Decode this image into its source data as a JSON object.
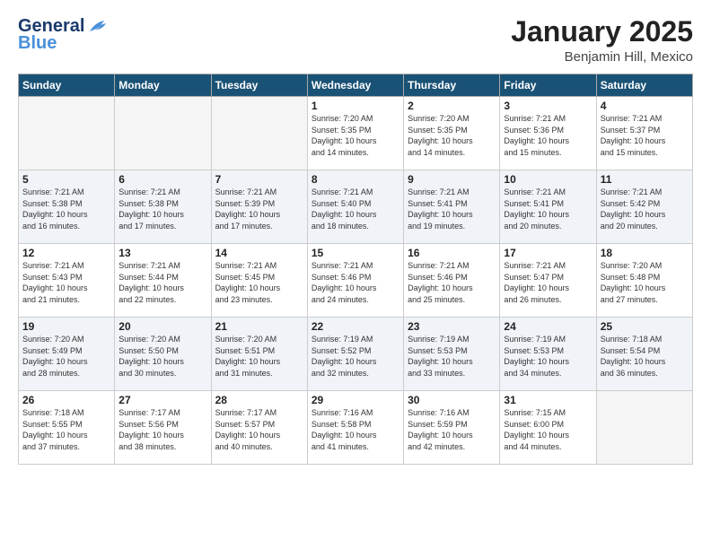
{
  "logo": {
    "line1": "General",
    "line2": "Blue"
  },
  "title": "January 2025",
  "subtitle": "Benjamin Hill, Mexico",
  "days_of_week": [
    "Sunday",
    "Monday",
    "Tuesday",
    "Wednesday",
    "Thursday",
    "Friday",
    "Saturday"
  ],
  "weeks": [
    [
      {
        "day": "",
        "info": ""
      },
      {
        "day": "",
        "info": ""
      },
      {
        "day": "",
        "info": ""
      },
      {
        "day": "1",
        "info": "Sunrise: 7:20 AM\nSunset: 5:35 PM\nDaylight: 10 hours\nand 14 minutes."
      },
      {
        "day": "2",
        "info": "Sunrise: 7:20 AM\nSunset: 5:35 PM\nDaylight: 10 hours\nand 14 minutes."
      },
      {
        "day": "3",
        "info": "Sunrise: 7:21 AM\nSunset: 5:36 PM\nDaylight: 10 hours\nand 15 minutes."
      },
      {
        "day": "4",
        "info": "Sunrise: 7:21 AM\nSunset: 5:37 PM\nDaylight: 10 hours\nand 15 minutes."
      }
    ],
    [
      {
        "day": "5",
        "info": "Sunrise: 7:21 AM\nSunset: 5:38 PM\nDaylight: 10 hours\nand 16 minutes."
      },
      {
        "day": "6",
        "info": "Sunrise: 7:21 AM\nSunset: 5:38 PM\nDaylight: 10 hours\nand 17 minutes."
      },
      {
        "day": "7",
        "info": "Sunrise: 7:21 AM\nSunset: 5:39 PM\nDaylight: 10 hours\nand 17 minutes."
      },
      {
        "day": "8",
        "info": "Sunrise: 7:21 AM\nSunset: 5:40 PM\nDaylight: 10 hours\nand 18 minutes."
      },
      {
        "day": "9",
        "info": "Sunrise: 7:21 AM\nSunset: 5:41 PM\nDaylight: 10 hours\nand 19 minutes."
      },
      {
        "day": "10",
        "info": "Sunrise: 7:21 AM\nSunset: 5:41 PM\nDaylight: 10 hours\nand 20 minutes."
      },
      {
        "day": "11",
        "info": "Sunrise: 7:21 AM\nSunset: 5:42 PM\nDaylight: 10 hours\nand 20 minutes."
      }
    ],
    [
      {
        "day": "12",
        "info": "Sunrise: 7:21 AM\nSunset: 5:43 PM\nDaylight: 10 hours\nand 21 minutes."
      },
      {
        "day": "13",
        "info": "Sunrise: 7:21 AM\nSunset: 5:44 PM\nDaylight: 10 hours\nand 22 minutes."
      },
      {
        "day": "14",
        "info": "Sunrise: 7:21 AM\nSunset: 5:45 PM\nDaylight: 10 hours\nand 23 minutes."
      },
      {
        "day": "15",
        "info": "Sunrise: 7:21 AM\nSunset: 5:46 PM\nDaylight: 10 hours\nand 24 minutes."
      },
      {
        "day": "16",
        "info": "Sunrise: 7:21 AM\nSunset: 5:46 PM\nDaylight: 10 hours\nand 25 minutes."
      },
      {
        "day": "17",
        "info": "Sunrise: 7:21 AM\nSunset: 5:47 PM\nDaylight: 10 hours\nand 26 minutes."
      },
      {
        "day": "18",
        "info": "Sunrise: 7:20 AM\nSunset: 5:48 PM\nDaylight: 10 hours\nand 27 minutes."
      }
    ],
    [
      {
        "day": "19",
        "info": "Sunrise: 7:20 AM\nSunset: 5:49 PM\nDaylight: 10 hours\nand 28 minutes."
      },
      {
        "day": "20",
        "info": "Sunrise: 7:20 AM\nSunset: 5:50 PM\nDaylight: 10 hours\nand 30 minutes."
      },
      {
        "day": "21",
        "info": "Sunrise: 7:20 AM\nSunset: 5:51 PM\nDaylight: 10 hours\nand 31 minutes."
      },
      {
        "day": "22",
        "info": "Sunrise: 7:19 AM\nSunset: 5:52 PM\nDaylight: 10 hours\nand 32 minutes."
      },
      {
        "day": "23",
        "info": "Sunrise: 7:19 AM\nSunset: 5:53 PM\nDaylight: 10 hours\nand 33 minutes."
      },
      {
        "day": "24",
        "info": "Sunrise: 7:19 AM\nSunset: 5:53 PM\nDaylight: 10 hours\nand 34 minutes."
      },
      {
        "day": "25",
        "info": "Sunrise: 7:18 AM\nSunset: 5:54 PM\nDaylight: 10 hours\nand 36 minutes."
      }
    ],
    [
      {
        "day": "26",
        "info": "Sunrise: 7:18 AM\nSunset: 5:55 PM\nDaylight: 10 hours\nand 37 minutes."
      },
      {
        "day": "27",
        "info": "Sunrise: 7:17 AM\nSunset: 5:56 PM\nDaylight: 10 hours\nand 38 minutes."
      },
      {
        "day": "28",
        "info": "Sunrise: 7:17 AM\nSunset: 5:57 PM\nDaylight: 10 hours\nand 40 minutes."
      },
      {
        "day": "29",
        "info": "Sunrise: 7:16 AM\nSunset: 5:58 PM\nDaylight: 10 hours\nand 41 minutes."
      },
      {
        "day": "30",
        "info": "Sunrise: 7:16 AM\nSunset: 5:59 PM\nDaylight: 10 hours\nand 42 minutes."
      },
      {
        "day": "31",
        "info": "Sunrise: 7:15 AM\nSunset: 6:00 PM\nDaylight: 10 hours\nand 44 minutes."
      },
      {
        "day": "",
        "info": ""
      }
    ]
  ]
}
